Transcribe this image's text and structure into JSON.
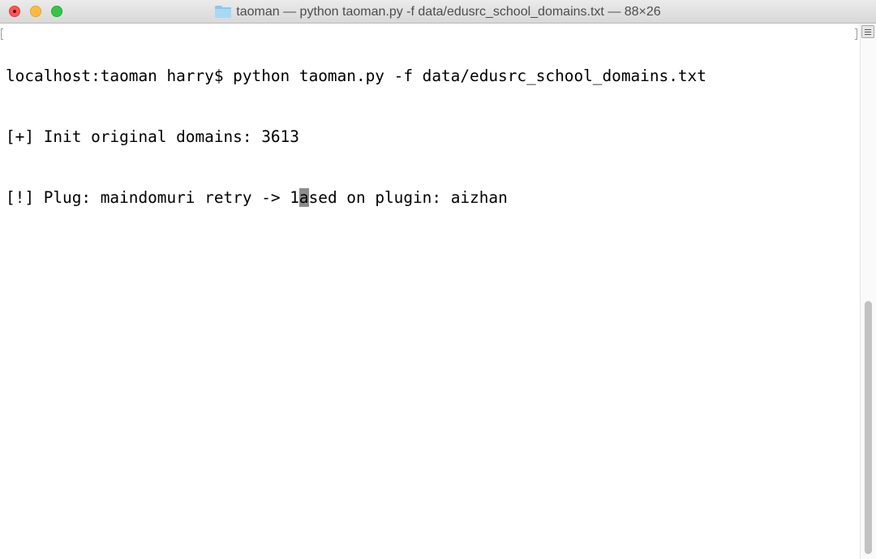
{
  "window": {
    "title": "taoman — python taoman.py -f data/edusrc_school_domains.txt — 88×26",
    "folder_icon": "folder-icon"
  },
  "terminal": {
    "lines": [
      "localhost:taoman harry$ python taoman.py -f data/edusrc_school_domains.txt",
      "[+] Init original domains: 3613"
    ],
    "line3_before_cursor": "[!] Plug: maindomuri retry -> 1",
    "cursor_char": "a",
    "line3_after_cursor": "sed on plugin: aizhan"
  },
  "colors": {
    "close": "#fc5753",
    "minimize": "#fdbc40",
    "zoom": "#33c748",
    "cursor": "#8c8c8c",
    "text": "#000000"
  }
}
